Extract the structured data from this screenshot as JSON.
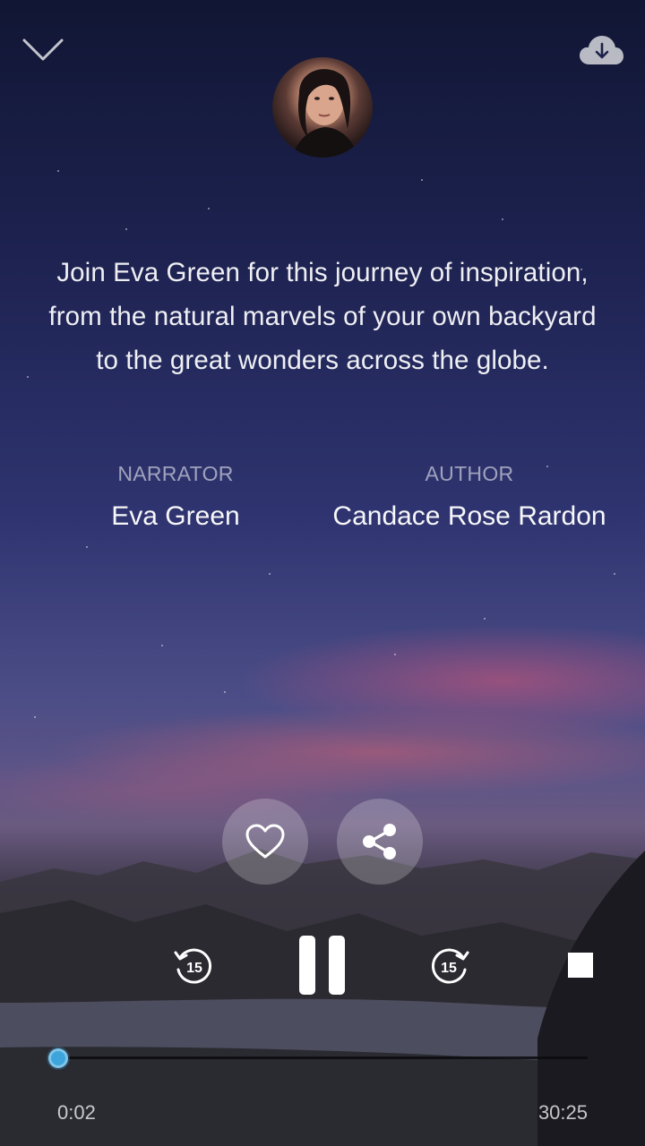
{
  "player": {
    "description": "Join Eva Green for this journey of inspiration, from the natural marvels of your own backyard to the great wonders across the globe.",
    "credits": [
      {
        "label": "NARRATOR",
        "value": "Eva Green"
      },
      {
        "label": "AUTHOR",
        "value": "Candace Rose Rardon"
      }
    ],
    "skip_back_seconds": "15",
    "skip_forward_seconds": "15",
    "elapsed_time": "0:02",
    "total_time": "30:25",
    "progress_fraction": 0.001
  },
  "icons": {
    "collapse": "chevron-down-icon",
    "download": "cloud-download-icon",
    "favorite": "heart-icon",
    "share": "share-icon",
    "rewind": "rewind-15-icon",
    "pause": "pause-icon",
    "forward": "forward-15-icon",
    "stop": "stop-icon"
  },
  "colors": {
    "accent": "#3da5dc",
    "button_bg": "rgba(255,255,255,0.22)"
  }
}
